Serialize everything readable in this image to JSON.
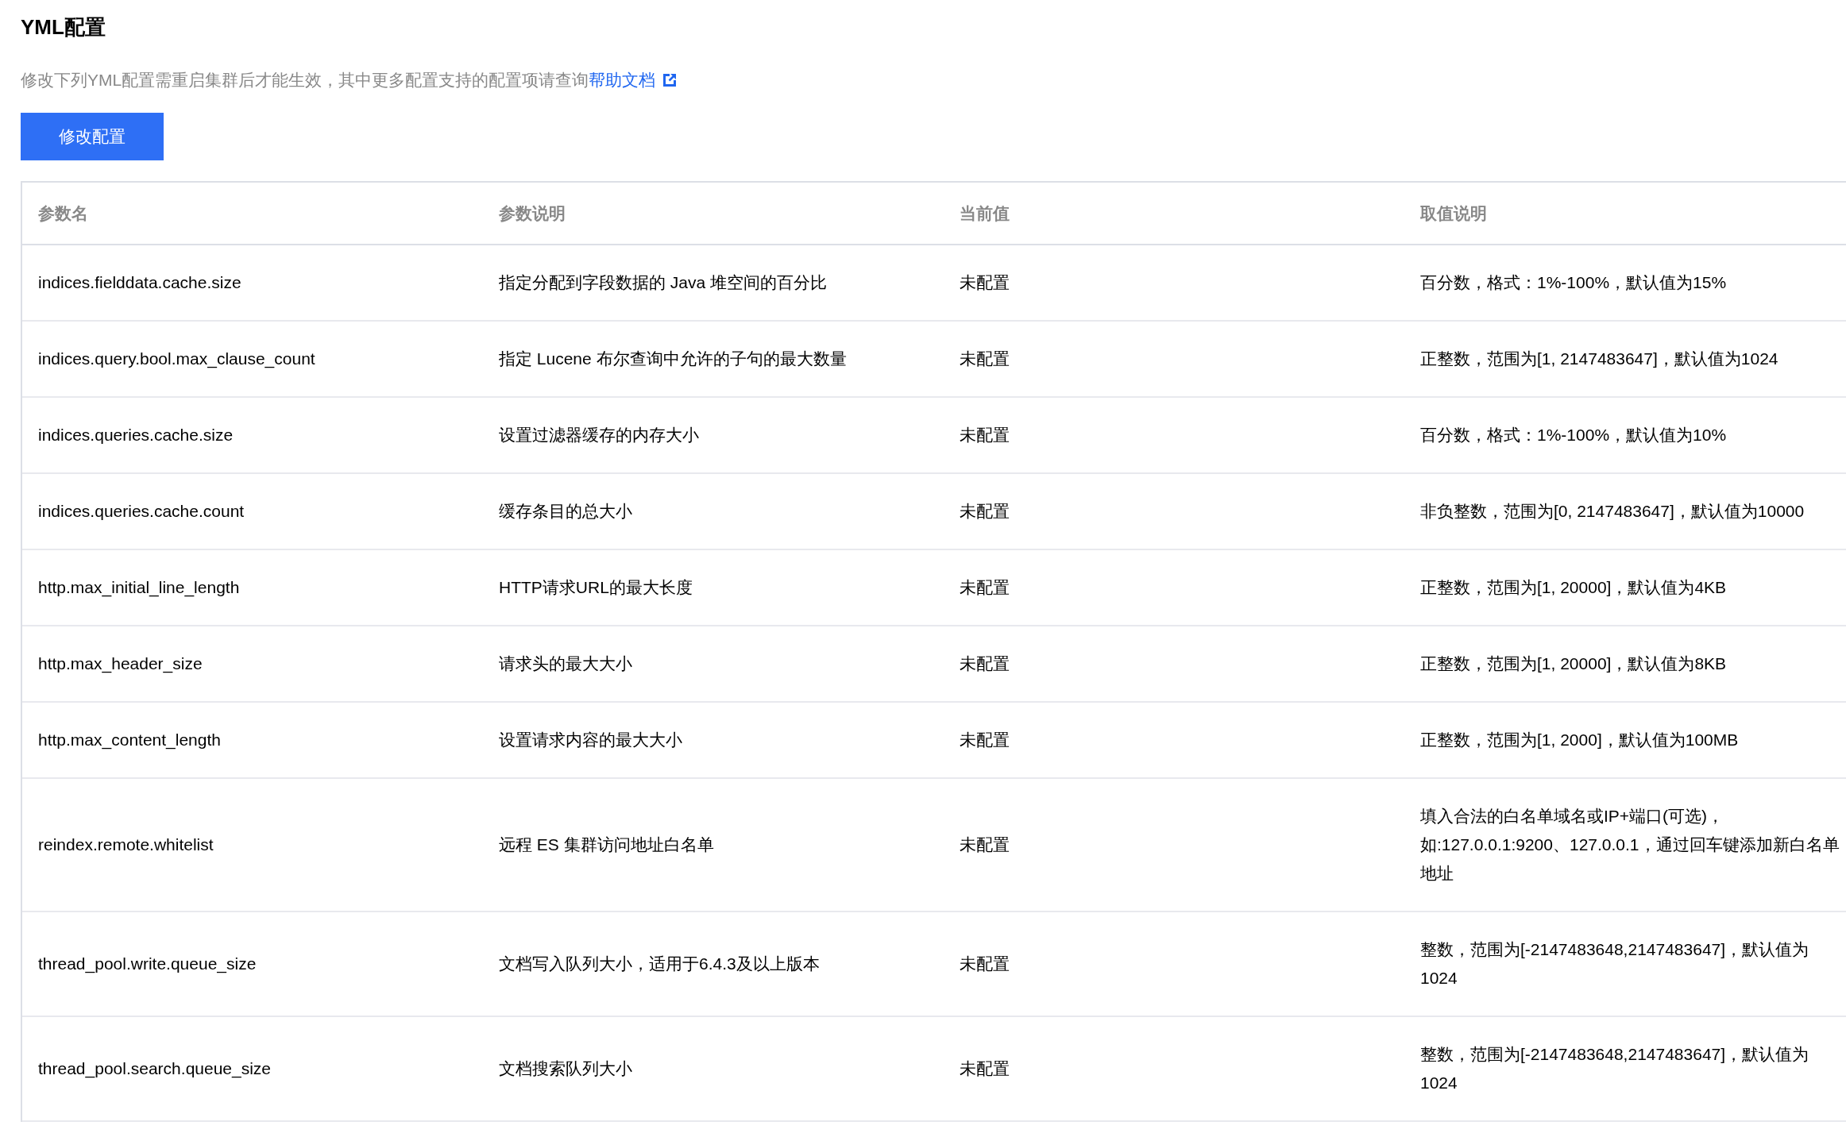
{
  "title": "YML配置",
  "description": {
    "text": "修改下列YML配置需重启集群后才能生效，其中更多配置支持的配置项请查询",
    "link": "帮助文档"
  },
  "button": "修改配置",
  "table": {
    "columns": [
      "参数名",
      "参数说明",
      "当前值",
      "取值说明"
    ],
    "rows": [
      {
        "name": "indices.fielddata.cache.size",
        "description": "指定分配到字段数据的 Java 堆空间的百分比",
        "current": "未配置",
        "value_range": "百分数，格式：1%-100%，默认值为15%"
      },
      {
        "name": "indices.query.bool.max_clause_count",
        "description": "指定 Lucene 布尔查询中允许的子句的最大数量",
        "current": "未配置",
        "value_range": "正整数，范围为[1, 2147483647]，默认值为1024"
      },
      {
        "name": "indices.queries.cache.size",
        "description": "设置过滤器缓存的内存大小",
        "current": "未配置",
        "value_range": "百分数，格式：1%-100%，默认值为10%"
      },
      {
        "name": "indices.queries.cache.count",
        "description": "缓存条目的总大小",
        "current": "未配置",
        "value_range": "非负整数，范围为[0, 2147483647]，默认值为10000"
      },
      {
        "name": "http.max_initial_line_length",
        "description": "HTTP请求URL的最大长度",
        "current": "未配置",
        "value_range": "正整数，范围为[1, 20000]，默认值为4KB"
      },
      {
        "name": "http.max_header_size",
        "description": "请求头的最大大小",
        "current": "未配置",
        "value_range": "正整数，范围为[1, 20000]，默认值为8KB"
      },
      {
        "name": "http.max_content_length",
        "description": "设置请求内容的最大大小",
        "current": "未配置",
        "value_range": "正整数，范围为[1, 2000]，默认值为100MB"
      },
      {
        "name": "reindex.remote.whitelist",
        "description": "远程 ES 集群访问地址白名单",
        "current": "未配置",
        "value_range": "填入合法的白名单域名或IP+端口(可选)，如:127.0.0.1:9200、127.0.0.1，通过回车键添加新白名单地址"
      },
      {
        "name": "thread_pool.write.queue_size",
        "description": "文档写入队列大小，适用于6.4.3及以上版本",
        "current": "未配置",
        "value_range": "整数，范围为[-2147483648,2147483647]，默认值为1024"
      },
      {
        "name": "thread_pool.search.queue_size",
        "description": "文档搜索队列大小",
        "current": "未配置",
        "value_range": "整数，范围为[-2147483648,2147483647]，默认值为1024"
      }
    ]
  }
}
